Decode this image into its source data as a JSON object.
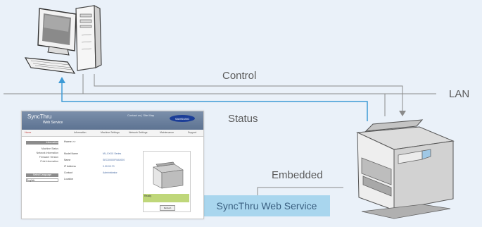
{
  "labels": {
    "control": "Control",
    "lan": "LAN",
    "status": "Status",
    "embedded": "Embedded",
    "service": "SyncThru Web Service"
  },
  "webpage": {
    "logo": "SyncThru",
    "logo_sub": "Web Service",
    "top_links": "Contact us  |  Site Map",
    "brand": "SAMSUNG",
    "home": "Home",
    "tabs": [
      "Information",
      "Machine Settings",
      "Network Settings",
      "Maintenance",
      "Support"
    ],
    "side_header": "Information",
    "side_items": [
      "Machine Status",
      "Network Information",
      "Firmware Version",
      "Print Information"
    ],
    "side_lang": "Select Language",
    "side_lang_value": "English",
    "crumb": "Home >>",
    "rows": [
      {
        "key": "Model Name",
        "value": "ML-XXXX Series"
      },
      {
        "key": "Name",
        "value": "SEC00000F0A0000"
      },
      {
        "key": "IP Address",
        "value": "0.00.00.70"
      },
      {
        "key": "Contact",
        "value": "Administrator"
      },
      {
        "key": "Location",
        "value": ""
      }
    ],
    "status": "Ready",
    "refresh": "Refresh"
  },
  "colors": {
    "background": "#eaf1f9",
    "network_line": "#8a8a8a",
    "status_line": "#3d9ad6",
    "service_box": "#a9d6ee"
  },
  "icons": [
    "desktop-computer-icon",
    "multifunction-printer-icon"
  ]
}
